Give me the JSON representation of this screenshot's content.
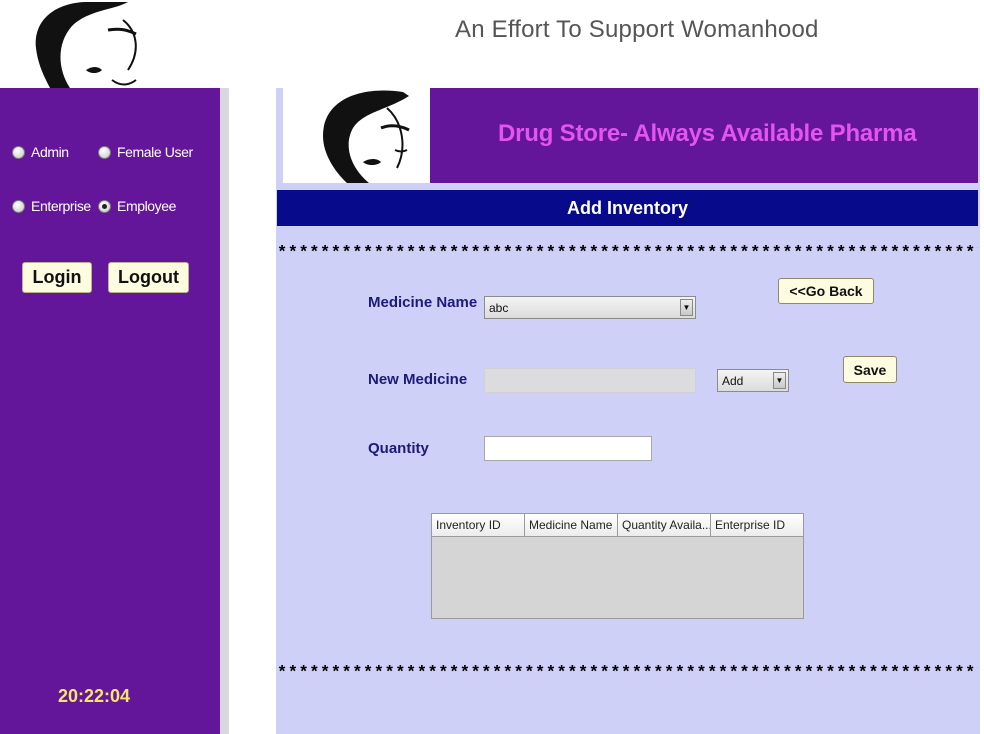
{
  "header": {
    "tagline": "An Effort To Support Womanhood"
  },
  "sidebar": {
    "radios": [
      {
        "label": "Admin",
        "checked": false
      },
      {
        "label": "Female User",
        "checked": false
      },
      {
        "label": "Enterprise",
        "checked": false
      },
      {
        "label": "Employee",
        "checked": true
      }
    ],
    "login_label": "Login",
    "logout_label": "Logout",
    "clock": "20:22:04"
  },
  "banner": {
    "title": "Drug Store- Always Available Pharma"
  },
  "form": {
    "title": "Add Inventory",
    "stars": "*******************************************************************************",
    "medicine_name_label": "Medicine Name",
    "medicine_name_value": "abc",
    "new_medicine_label": "New Medicine",
    "new_medicine_value": "",
    "add_combo_value": "Add",
    "quantity_label": "Quantity",
    "quantity_value": "",
    "go_back_label": "<<Go Back",
    "save_label": "Save"
  },
  "table": {
    "columns": [
      "Inventory ID",
      "Medicine Name",
      "Quantity Availa...",
      "Enterprise ID"
    ],
    "rows": []
  },
  "colors": {
    "purple": "#64169a",
    "navy": "#060a8b",
    "lavender": "#cfd0f7",
    "banner_text": "#e255f0",
    "clock": "#f5e56a"
  },
  "icons": [
    "woman-face-logo-icon",
    "chevron-down-icon",
    "radio-icon"
  ]
}
